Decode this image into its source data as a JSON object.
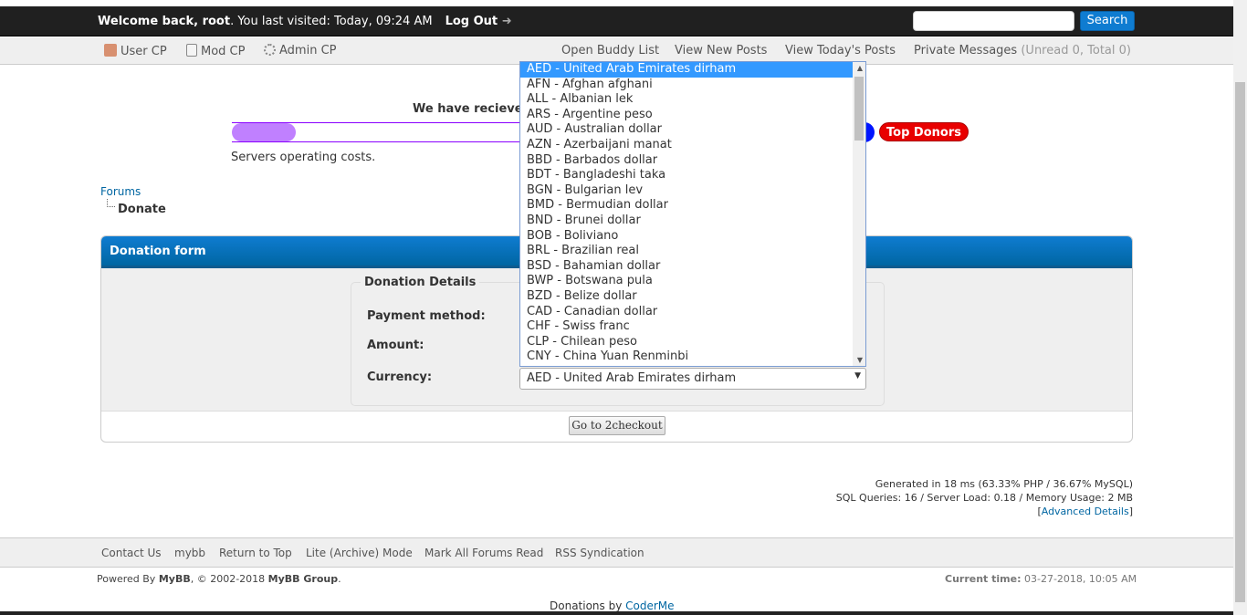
{
  "header": {
    "welcome_bold": "Welcome back, root",
    "welcome_rest": ". You last visited: Today, 09:24 AM",
    "logout": "Log Out",
    "logout_icon": "arrow-right-icon",
    "search_placeholder": "",
    "search_button": "Search"
  },
  "nav": {
    "left": [
      {
        "label": "User CP",
        "icon": "user-icon"
      },
      {
        "label": "Mod CP",
        "icon": "notepad-icon"
      },
      {
        "label": "Admin CP",
        "icon": "gear-icon"
      }
    ],
    "right": {
      "buddy": "Open Buddy List",
      "new_posts": "View New Posts",
      "today_posts": "View Today's Posts",
      "pm": "Private Messages",
      "pm_counts": "(Unread 0, Total 0)"
    }
  },
  "donation_goal": {
    "title": "We have recieve",
    "progress_percent": 10,
    "description": "Servers operating costs.",
    "top_donors": "Top Donors",
    "colors": {
      "fill": "#c080ff",
      "border": "#8a00ff"
    }
  },
  "breadcrumb": {
    "forums": "Forums",
    "current": "Donate"
  },
  "form": {
    "title": "Donation form",
    "legend": "Donation Details",
    "payment_label": "Payment method:",
    "amount_label": "Amount:",
    "currency_label": "Currency:",
    "currency_value": "AED - United Arab Emirates dirham",
    "submit": "Go to 2checkout",
    "currency_options": [
      "AED - United Arab Emirates dirham",
      "AFN - Afghan afghani",
      "ALL - Albanian lek",
      "ARS - Argentine peso",
      "AUD - Australian dollar",
      "AZN - Azerbaijani manat",
      "BBD - Barbados dollar",
      "BDT - Bangladeshi taka",
      "BGN - Bulgarian lev",
      "BMD - Bermudian dollar",
      "BND - Brunei dollar",
      "BOB - Boliviano",
      "BRL - Brazilian real",
      "BSD - Bahamian dollar",
      "BWP - Botswana pula",
      "BZD - Belize dollar",
      "CAD - Canadian dollar",
      "CHF - Swiss franc",
      "CLP - Chilean peso",
      "CNY - China Yuan Renminbi"
    ]
  },
  "stats": {
    "line1": "Generated in 18 ms (63.33% PHP / 36.67% MySQL)",
    "line2": "SQL Queries: 16 / Server Load: 0.18 / Memory Usage: 2 MB",
    "advanced": "Advanced Details"
  },
  "footer": {
    "links": [
      "Contact Us",
      "mybb",
      "Return to Top",
      "Lite (Archive) Mode",
      "Mark All Forums Read",
      "RSS Syndication"
    ],
    "powered_pre": "Powered By ",
    "powered_mybb": "MyBB",
    "powered_mid": ", © 2002-2018 ",
    "powered_group": "MyBB Group",
    "powered_end": ".",
    "current_time_label": "Current time:",
    "current_time": "03-27-2018, 10:05 AM",
    "donations_by": "Donations by ",
    "coder": "CoderMe"
  }
}
